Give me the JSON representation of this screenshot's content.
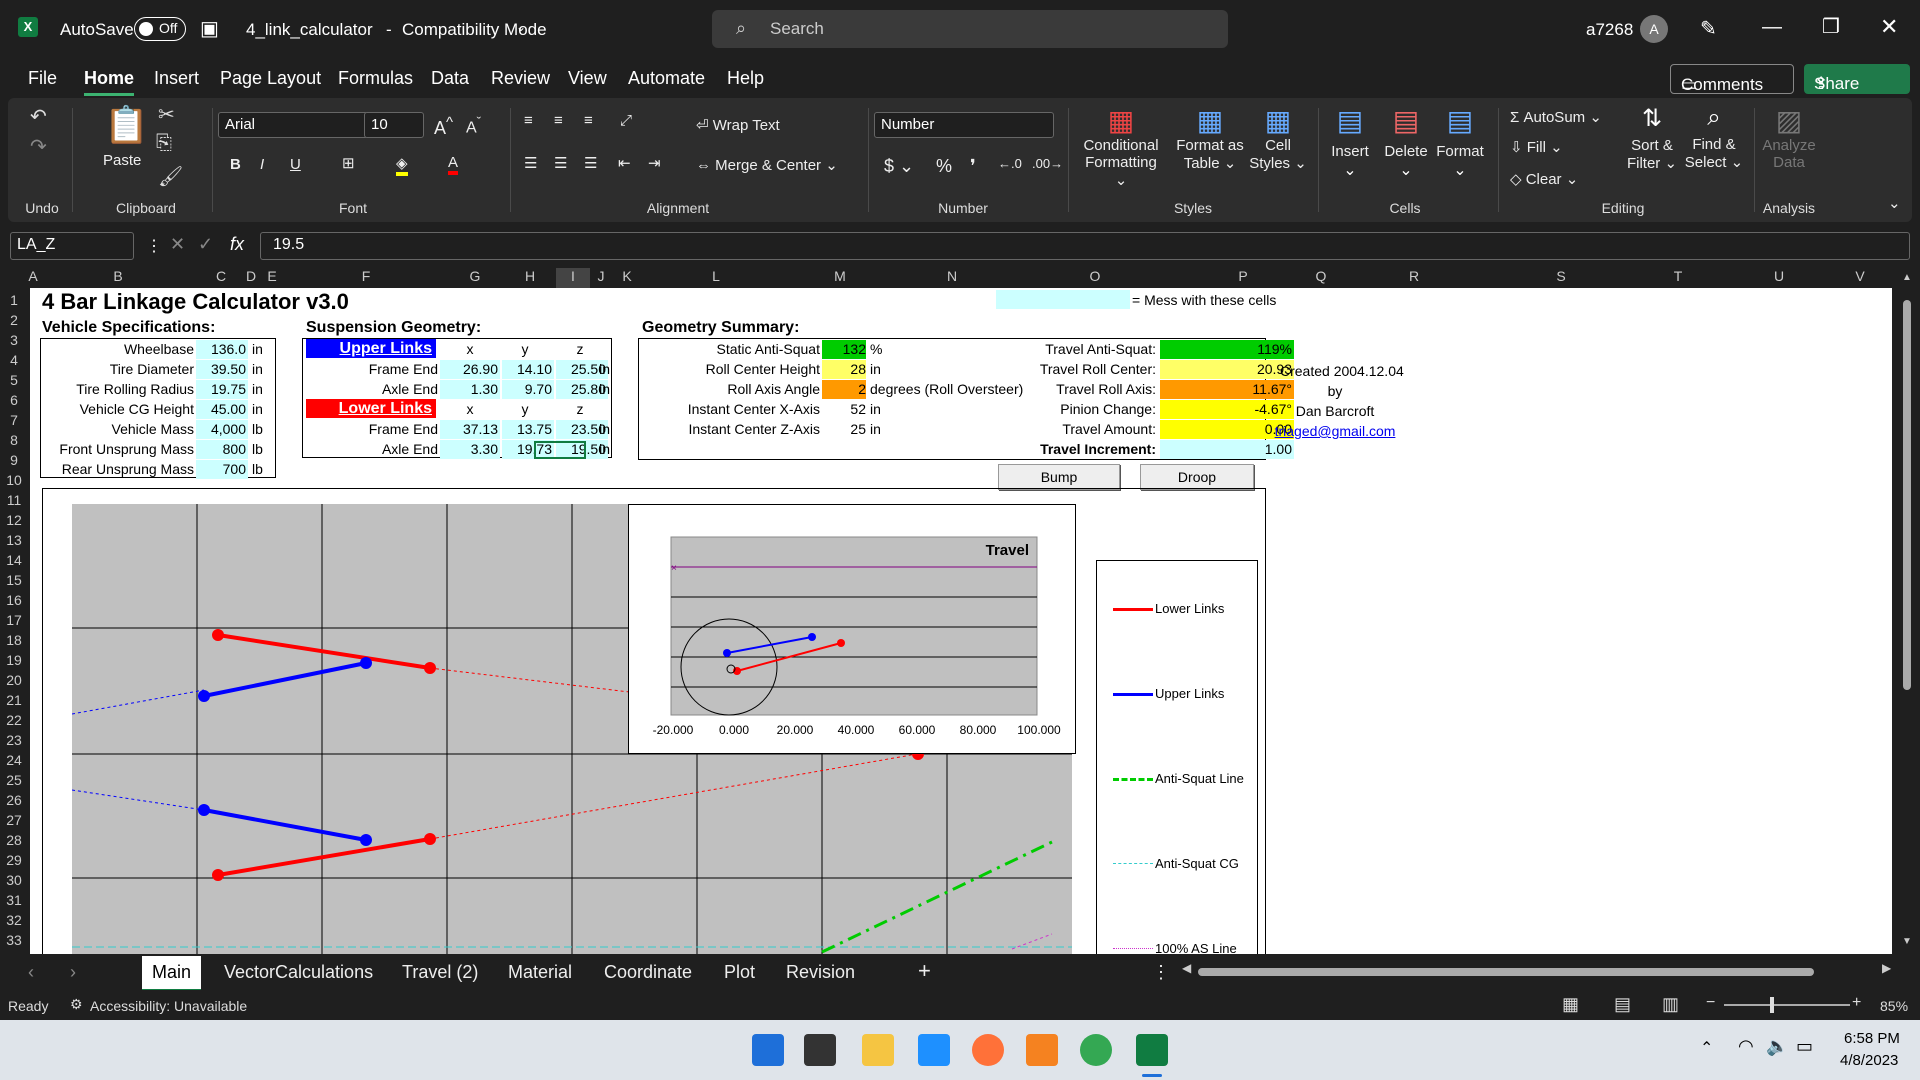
{
  "titlebar": {
    "autosave": "AutoSave",
    "toggle": "Off",
    "filename": "4_link_calculator",
    "mode": "Compatibility Mode",
    "search_placeholder": "Search",
    "user": "a7268",
    "avatar": "A"
  },
  "menu": [
    "File",
    "Home",
    "Insert",
    "Page Layout",
    "Formulas",
    "Data",
    "Review",
    "View",
    "Automate",
    "Help"
  ],
  "comments": "Comments",
  "share": "Share",
  "ribbon": {
    "undo": "Undo",
    "paste": "Paste",
    "clipboard": "Clipboard",
    "font_name": "Arial",
    "font_size": "10",
    "font": "Font",
    "wrap": "Wrap Text",
    "merge": "Merge & Center",
    "alignment": "Alignment",
    "numfmt": "Number",
    "number": "Number",
    "cond": "Conditional",
    "cond2": "Formatting",
    "fat": "Format as",
    "fat2": "Table",
    "cellstyles": "Cell",
    "cellstyles2": "Styles",
    "styles": "Styles",
    "insert": "Insert",
    "delete": "Delete",
    "format": "Format",
    "cells": "Cells",
    "autosum": "AutoSum",
    "fill": "Fill",
    "clear": "Clear",
    "sort": "Sort &",
    "sort2": "Filter",
    "find": "Find &",
    "find2": "Select",
    "editing": "Editing",
    "analyze": "Analyze",
    "analyze2": "Data",
    "analysis": "Analysis"
  },
  "formula": {
    "namebox": "LA_Z",
    "fx": "fx",
    "value": "19.5"
  },
  "columns": [
    "A",
    "B",
    "C",
    "D",
    "E",
    "F",
    "G",
    "H",
    "I",
    "J",
    "K",
    "L",
    "M",
    "N",
    "O",
    "P",
    "Q",
    "R",
    "S",
    "T",
    "U",
    "V"
  ],
  "rows": [
    "1",
    "2",
    "3",
    "4",
    "5",
    "6",
    "7",
    "8",
    "9",
    "10",
    "11",
    "12",
    "13",
    "14",
    "15",
    "16",
    "17",
    "18",
    "19",
    "20",
    "21",
    "22",
    "23",
    "24",
    "25",
    "26",
    "27",
    "28",
    "29",
    "30",
    "31",
    "32",
    "33"
  ],
  "sheet": {
    "title": "4 Bar Linkage Calculator v3.0",
    "mess": "= Mess with these cells",
    "veh_head": "Vehicle Specifications:",
    "veh": [
      [
        "Wheelbase",
        "136.0",
        "in"
      ],
      [
        "Tire Diameter",
        "39.50",
        "in"
      ],
      [
        "Tire Rolling Radius",
        "19.75",
        "in"
      ],
      [
        "Vehicle CG Height",
        "45.00",
        "in"
      ],
      [
        "Vehicle Mass",
        "4,000",
        "lb"
      ],
      [
        "Front Unsprung Mass",
        "800",
        "lb"
      ],
      [
        "Rear Unsprung Mass",
        "700",
        "lb"
      ]
    ],
    "susp_head": "Suspension Geometry:",
    "upper": "Upper Links",
    "lower": "Lower Links",
    "x": "x",
    "y": "y",
    "z": "z",
    "uf": [
      "Frame End",
      "26.90",
      "14.10",
      "25.50",
      "in"
    ],
    "ua": [
      "Axle End",
      "1.30",
      "9.70",
      "25.80",
      "in"
    ],
    "lf": [
      "Frame End",
      "37.13",
      "13.75",
      "23.50",
      "in"
    ],
    "la": [
      "Axle End",
      "3.30",
      "19.73",
      "19.50",
      "in"
    ],
    "geo_head": "Geometry Summary:",
    "geo": [
      [
        "Static Anti-Squat",
        "132",
        "%"
      ],
      [
        "Roll Center Height",
        "28",
        "in"
      ],
      [
        "Roll Axis Angle",
        "2",
        "degrees (Roll Oversteer)"
      ],
      [
        "Instant Center X-Axis",
        "52",
        "in"
      ],
      [
        "Instant Center Z-Axis",
        "25",
        "in"
      ]
    ],
    "trav": [
      [
        "Travel Anti-Squat:",
        "119%"
      ],
      [
        "Travel Roll Center:",
        "20.93"
      ],
      [
        "Travel Roll Axis:",
        "11.67°"
      ],
      [
        "Pinion Change:",
        "-4.67°"
      ],
      [
        "Travel Amount:",
        "0.00"
      ],
      [
        "Travel Increment:",
        "1.00"
      ]
    ],
    "created": "Created 2004.12.04",
    "by": "by",
    "author": "Dan Barcroft",
    "email": "triaged@gmail.com",
    "bump": "Bump",
    "droop": "Droop"
  },
  "inset": {
    "title": "Travel",
    "xticks": [
      "-20.000",
      "0.000",
      "20.000",
      "40.000",
      "60.000",
      "80.000",
      "100.000"
    ]
  },
  "legend": [
    "Lower Links",
    "Upper Links",
    "Anti-Squat Line",
    "Anti-Squat CG",
    "100% AS Line"
  ],
  "colors": {
    "lower": "#ff0000",
    "upper": "#0000ff",
    "antisquat": "#00cc00",
    "ascg": "#33cccc",
    "as100": "#cc33cc",
    "green_cell": "#00cc00",
    "yellow_cell": "#ffff66",
    "orange_cell": "#ff9900"
  },
  "tabs": [
    "Main",
    "VectorCalculations",
    "Travel (2)",
    "Material",
    "Coordinate",
    "Plot",
    "Revision"
  ],
  "status": {
    "ready": "Ready",
    "access": "Accessibility: Unavailable",
    "zoom": "85%"
  },
  "clock": {
    "time": "6:58 PM",
    "date": "4/8/2023"
  }
}
